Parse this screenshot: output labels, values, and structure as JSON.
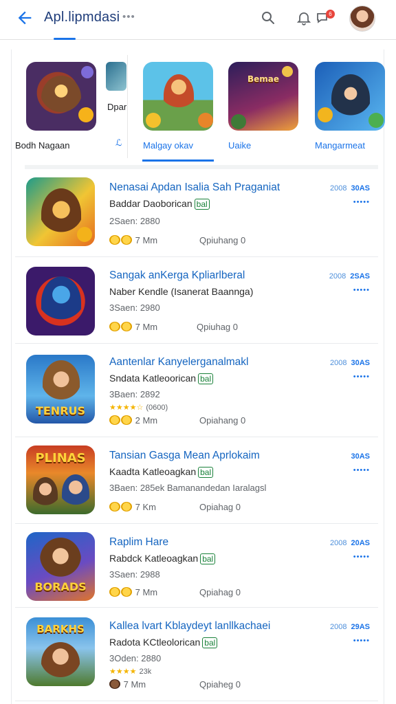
{
  "header": {
    "title": "Apl.lipmdasi",
    "more": "•••",
    "badge": "6"
  },
  "icons": {
    "back": "arrow-left-icon",
    "search": "search-icon",
    "bell": "bell-icon",
    "chat": "chat-icon"
  },
  "featured": [
    {
      "label": "Bodh Nagaan"
    },
    {
      "label": "Dpar"
    },
    {
      "label": "Malgay okav"
    },
    {
      "label": "Uaike"
    },
    {
      "label": "Mangarmeat"
    }
  ],
  "list": [
    {
      "title": "Nenasai Apdan Isalia Sah Praganiat",
      "subtitle": "Baddar Daoborican",
      "tag": "bal",
      "meta": "2Saen: 2880",
      "stars": "",
      "rating": "7 Mm",
      "status": "Qpiuhang 0",
      "side_pre": "2008",
      "side": "30AS",
      "dots": "•••••"
    },
    {
      "title": "Sangak anKerga Kpliarlberal",
      "subtitle": "Naber Kendle (Isanerat Baannga)",
      "tag": "",
      "meta": "3Saen: 2980",
      "stars": "",
      "rating": "7 Mm",
      "status": "Qpiuhag 0",
      "side_pre": "2008",
      "side": "2SAS",
      "dots": "•••••"
    },
    {
      "title": "Aantenlar Kanyelerganalmakl",
      "subtitle": "Sndata Katleoorican",
      "tag": "bal",
      "meta": "3Baen: 2892",
      "stars": "★★★★☆",
      "stars_note": "(0600)",
      "rating": "2 Mm",
      "status": "Opiahang 0",
      "side_pre": "2008",
      "side": "30AS",
      "dots": "•••••"
    },
    {
      "title": "Tansian Gasga Mean Aprlokaim",
      "subtitle": "Kaadta Katleoagkan",
      "tag": "bal",
      "meta": "3Baen: 285ek Bamanandedan Iaralagsl",
      "stars": "",
      "rating": "7 Km",
      "status": "Opiahag 0",
      "side_pre": "",
      "side": "30AS",
      "dots": "•••••"
    },
    {
      "title": "Raplim Hare",
      "subtitle": "Rabdck Katleoagkan",
      "tag": "bal",
      "meta": "3Saen: 2988",
      "stars": "",
      "rating": "7 Mm",
      "status": "Qpiahag 0",
      "side_pre": "2008",
      "side": "20AS",
      "dots": "•••••"
    },
    {
      "title": "Kallea lvart Kblaydeyt lanllkachaei",
      "subtitle": "Radota KCtleolorican",
      "tag": "bal",
      "meta": "3Oden: 2880",
      "stars": "★★★★",
      "stars_note": "23k",
      "rating": "7 Mm",
      "status": "Qpiaheg 0",
      "side_pre": "2008",
      "side": "29AS",
      "dots": "•••••"
    }
  ],
  "art_words": {
    "row3": "TENRUS",
    "row4": "PLINAS",
    "row5": "BORADS",
    "row6": "BARKHS",
    "feat4": "Bemae"
  },
  "colors": {
    "accent": "#1a73e8",
    "title": "#1565c0",
    "star": "#f4b400",
    "tag": "#188038"
  }
}
